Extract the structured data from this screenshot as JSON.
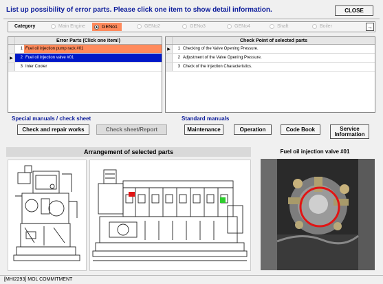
{
  "header": {
    "instruction": "List up possibility of error parts. Please click one item to show detail information.",
    "close_label": "CLOSE"
  },
  "category": {
    "label": "Category",
    "options": [
      "Main Engine",
      "GENo1",
      "GENo2",
      "GENo3",
      "GENo4",
      "Shaft",
      "Boiler"
    ],
    "selected": "GENo1",
    "arrow": "→"
  },
  "error_parts": {
    "header": "Error Parts (Click one item!)",
    "rows": [
      {
        "num": "1",
        "text": "Fuel oil injection pump rack #01",
        "state": "highlight"
      },
      {
        "num": "2",
        "text": "Fuel oil injection valve #01",
        "state": "selected"
      },
      {
        "num": "3",
        "text": "Inter Cooler",
        "state": "normal"
      }
    ],
    "row_pointer": "▶"
  },
  "check_points": {
    "header": "Check Point of selected parts",
    "rows": [
      {
        "num": "1",
        "text": "Checking of the Valve Opening Pressure."
      },
      {
        "num": "2",
        "text": "Adjustment of the Valve Opening Pressure."
      },
      {
        "num": "3",
        "text": "Check of the Injection Characteristics."
      }
    ],
    "row_pointer": "▶"
  },
  "special_manuals": {
    "title": "Special manuals / check sheet",
    "check_repair_label": "Check and repair works",
    "check_sheet_label": "Check sheet/Report"
  },
  "standard_manuals": {
    "title": "Standard manuals",
    "maintenance_label": "Maintenance",
    "operation_label": "Operation",
    "code_book_label": "Code Book",
    "service_line1": "Service",
    "service_line2": "Information"
  },
  "arrangement": {
    "title": "Arrangement of selected parts"
  },
  "part_detail": {
    "title": "Fuel oil injection valve #01"
  },
  "status_bar": {
    "text": "[MHI2293] MOL COMMITMENT"
  },
  "colors": {
    "title_blue": "#0a1a9a",
    "highlight_orange": "#ff8a5c",
    "selected_blue": "#0018c8",
    "marker_red": "#e01515",
    "marker_green": "#2ecc2e"
  }
}
